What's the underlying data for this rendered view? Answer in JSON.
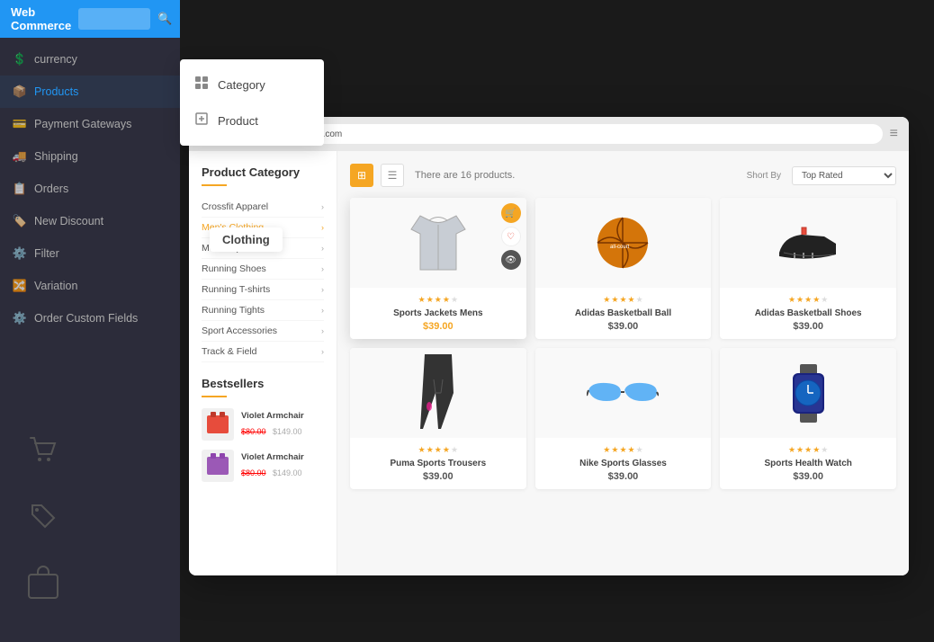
{
  "app": {
    "title": "Web Commerce",
    "url": "https › domain.com"
  },
  "sidebar": {
    "items": [
      {
        "label": "currency",
        "icon": "💲",
        "active": false
      },
      {
        "label": "Products",
        "icon": "📦",
        "active": true
      },
      {
        "label": "Payment Gateways",
        "icon": "💳",
        "active": false
      },
      {
        "label": "Shipping",
        "icon": "🚚",
        "active": false
      },
      {
        "label": "Orders",
        "icon": "📋",
        "active": false
      },
      {
        "label": "New Discount",
        "icon": "🏷️",
        "active": false
      },
      {
        "label": "Filter",
        "icon": "⚙️",
        "active": false
      },
      {
        "label": "Variation",
        "icon": "🔀",
        "active": false
      },
      {
        "label": "Order Custom Fields",
        "icon": "⚙️",
        "active": false
      }
    ]
  },
  "dropdown": {
    "items": [
      {
        "label": "Category",
        "icon": "category"
      },
      {
        "label": "Product",
        "icon": "product"
      }
    ]
  },
  "browser": {
    "url": "https › domain.com"
  },
  "category_panel": {
    "title": "Product Category",
    "items": [
      {
        "label": "Crossfit Apparel",
        "active": false
      },
      {
        "label": "Men's Clothing",
        "active": true
      },
      {
        "label": "Most Popular",
        "active": false
      },
      {
        "label": "Running Shoes",
        "active": false
      },
      {
        "label": "Running T-shirts",
        "active": false
      },
      {
        "label": "Running Tights",
        "active": false
      },
      {
        "label": "Sport Accessories",
        "active": false
      },
      {
        "label": "Track & Field",
        "active": false
      }
    ]
  },
  "bestsellers": {
    "title": "Bestsellers",
    "items": [
      {
        "name": "Violet Armchair",
        "price_new": "$80.00",
        "price_old": "$149.00"
      },
      {
        "name": "Violet Armchair",
        "price_new": "$80.00",
        "price_old": "$149.00"
      }
    ]
  },
  "toolbar": {
    "products_count": "There are 16 products.",
    "sort_label": "Short By",
    "sort_value": "Top Rated"
  },
  "products": [
    {
      "name": "Sports Jackets Mens",
      "price": "$39.00",
      "stars": 4,
      "featured": true
    },
    {
      "name": "Adidas Basketball Ball",
      "price": "$39.00",
      "stars": 4,
      "featured": false
    },
    {
      "name": "Adidas Basketball Shoes",
      "price": "$39.00",
      "stars": 4,
      "featured": false
    },
    {
      "name": "Puma Sports Trousers",
      "price": "$39.00",
      "stars": 4,
      "featured": false
    },
    {
      "name": "Nike Sports Glasses",
      "price": "$39.00",
      "stars": 4,
      "featured": false
    },
    {
      "name": "Sports Health Watch",
      "price": "$39.00",
      "stars": 4,
      "featured": false
    }
  ],
  "clothing_badge": {
    "label": "Clothing"
  }
}
